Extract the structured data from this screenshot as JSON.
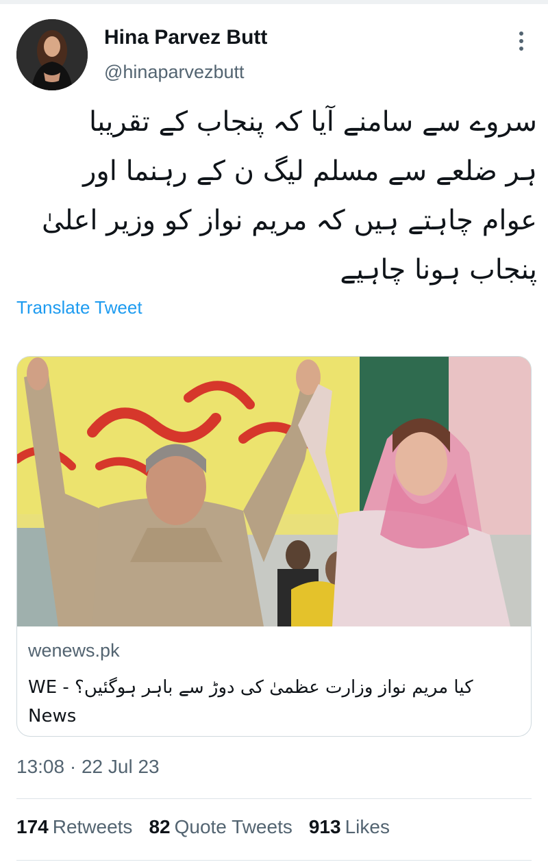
{
  "author": {
    "name": "Hina Parvez Butt",
    "handle": "@hinaparvezbutt"
  },
  "tweet": {
    "text": "سروے سے سامنے آیا کہ پنجاب کے تقریبا\nہر ضلعے سے مسلم لیگ ن کے رہنما اور\nعوام چاہتے ہیں کہ مریم نواز کو وزیر اعلیٰ\nپنجاب ہونا چاہیے",
    "translate_label": "Translate Tweet"
  },
  "card": {
    "domain": "wenews.pk",
    "title": "کیا مریم نواز وزارت عظمیٰ کی دوڑ سے باہر ہوگئیں؟ - WE News"
  },
  "meta": {
    "timestamp": "13:08 · 22 Jul 23"
  },
  "stats": {
    "retweets_count": "174",
    "retweets_label": "Retweets",
    "quotes_count": "82",
    "quotes_label": "Quote Tweets",
    "likes_count": "913",
    "likes_label": "Likes"
  },
  "colors": {
    "accent": "#1d9bf0",
    "secondary_text": "#536471",
    "primary_text": "#0f1419",
    "border": "#cfd9de"
  }
}
